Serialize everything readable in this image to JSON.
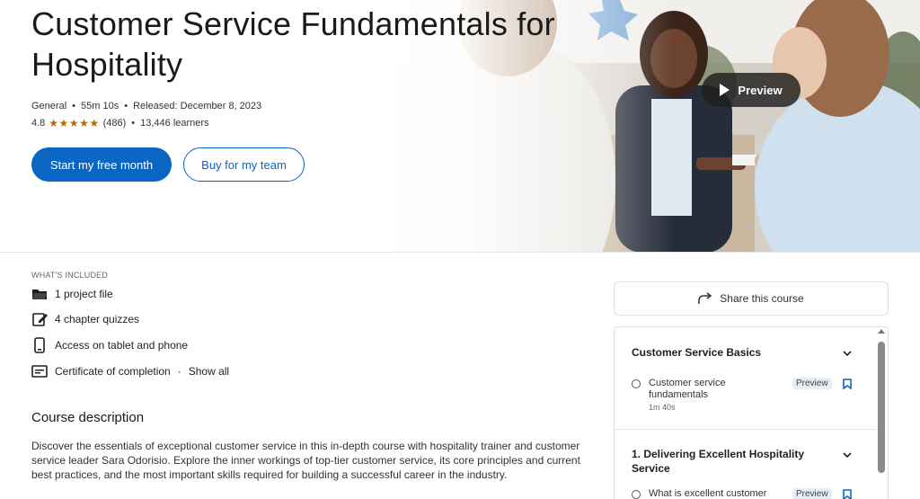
{
  "course": {
    "title": "Customer Service Fundamentals for Hospitality",
    "category": "General",
    "duration": "55m 10s",
    "released": "Released: December 8, 2023",
    "rating": "4.8",
    "stars": "★★★★★",
    "rating_count": "(486)",
    "learners": "13,446 learners"
  },
  "actions": {
    "primary": "Start my free month",
    "secondary": "Buy for my team",
    "preview": "Preview",
    "share": "Share this course"
  },
  "included": {
    "label": "WHAT'S INCLUDED",
    "items": [
      {
        "icon": "folder-icon",
        "label": "1 project file"
      },
      {
        "icon": "quiz-edit-icon",
        "label": "4 chapter quizzes"
      },
      {
        "icon": "phone-icon",
        "label": "Access on tablet and phone"
      },
      {
        "icon": "certificate-icon",
        "label": "Certificate of completion"
      }
    ],
    "show_all": "Show all"
  },
  "description": {
    "title": "Course description",
    "text": "Discover the essentials of exceptional customer service in this in-depth course with hospitality trainer and customer service leader Sara Odorisio. Explore the inner workings of top-tier customer service, its core principles and current best practices, and the most important skills required for building a successful career in the industry."
  },
  "toc": {
    "sections": [
      {
        "title": "Customer Service Basics",
        "items": [
          {
            "title": "Customer service fundamentals",
            "duration": "1m 40s",
            "badge": "Preview"
          }
        ]
      },
      {
        "title": "1. Delivering Excellent Hospitality Service",
        "items": [
          {
            "title": "What is excellent customer",
            "duration": "",
            "badge": "Preview"
          }
        ]
      }
    ]
  },
  "colors": {
    "brand": "#0a66c2",
    "star": "#b4690e"
  }
}
